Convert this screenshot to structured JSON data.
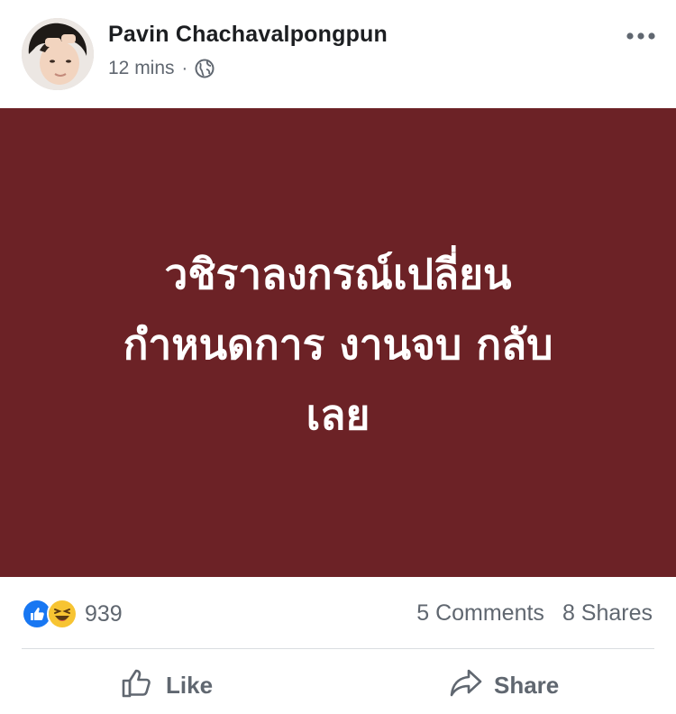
{
  "post": {
    "author": "Pavin Chachavalpongpun",
    "time": "12 mins",
    "separator": "·",
    "privacy_icon": "globe-icon",
    "card_color": "#6c2226",
    "text_lines": [
      "วชิราลงกรณ์เปลี่ยน",
      "กำหนดการ งานจบ กลับ",
      "เลย"
    ]
  },
  "stats": {
    "reaction_icons": [
      "like-reaction-icon",
      "haha-reaction-icon"
    ],
    "reaction_count": "939",
    "comments": "5 Comments",
    "shares": "8 Shares"
  },
  "actions": {
    "like_label": "Like",
    "share_label": "Share"
  }
}
